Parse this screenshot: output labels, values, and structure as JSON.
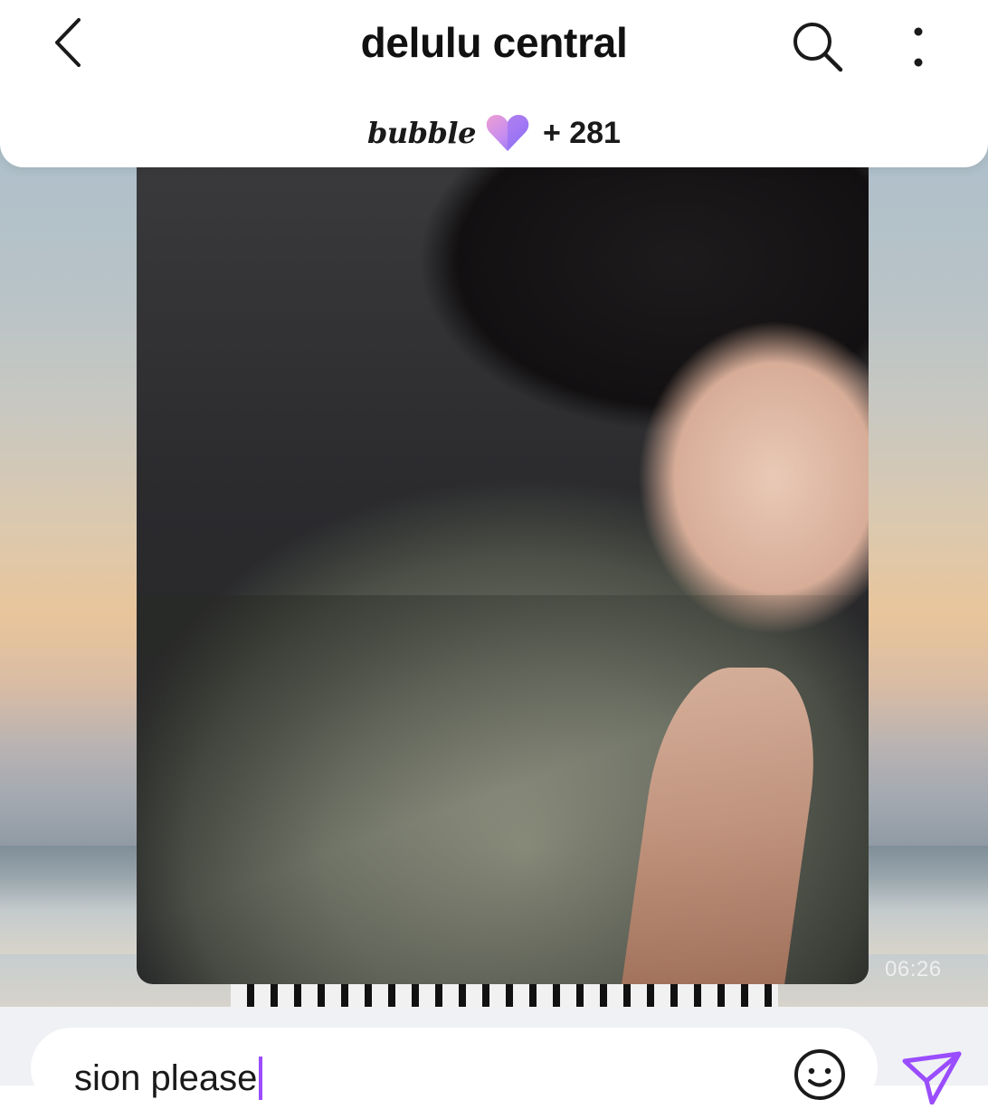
{
  "header": {
    "title": "delulu central",
    "brand": "bubble",
    "member_count": "+ 281",
    "icons": {
      "back": "chevron-left-icon",
      "search": "search-icon",
      "more": "more-vertical-icon",
      "logo": "bubble-heart-icon"
    }
  },
  "message": {
    "timestamp": "06:26"
  },
  "composer": {
    "input_value": "sion please",
    "icons": {
      "emoji": "emoji-icon",
      "send": "send-icon"
    }
  },
  "colors": {
    "accent": "#9a4dff",
    "heart_pink": "#e79ad6",
    "heart_purple": "#8d6cf5"
  }
}
